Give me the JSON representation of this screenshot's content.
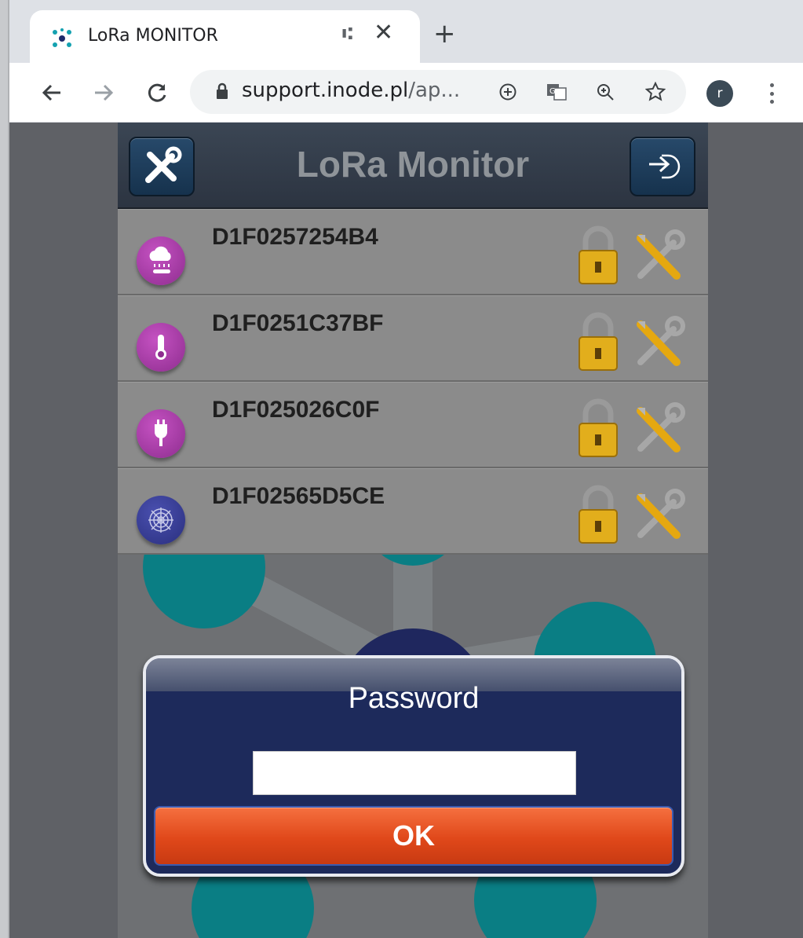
{
  "browser": {
    "tab": {
      "title": "LoRa MONITOR",
      "usb_icon": "usb-icon",
      "close_glyph": "✕"
    },
    "new_tab_glyph": "+",
    "address_bar": {
      "url_host": "support.inode.pl",
      "url_path": "/ap..."
    },
    "profile_initial": "r"
  },
  "app": {
    "title": "LoRa Monitor",
    "left_button_icon": "tools-icon",
    "right_button_icon": "login-arrow-icon"
  },
  "devices": [
    {
      "id": "D1F0257254B4",
      "icon": "weather-sensor-icon",
      "color": "#8e2d8f"
    },
    {
      "id": "D1F0251C37BF",
      "icon": "thermometer-icon",
      "color": "#8e2d8f"
    },
    {
      "id": "D1F025026C0F",
      "icon": "plug-icon",
      "color": "#8e2d8f"
    },
    {
      "id": "D1F02565D5CE",
      "icon": "spider-web-icon",
      "color": "#2a2f7e"
    }
  ],
  "dialog": {
    "title": "Password",
    "input_value": "",
    "ok_label": "OK"
  }
}
